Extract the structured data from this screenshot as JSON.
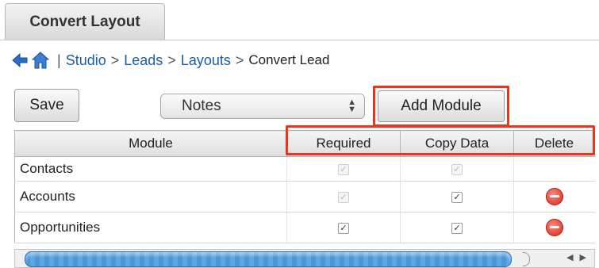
{
  "tab": {
    "label": "Convert Layout"
  },
  "breadcrumb": {
    "items": [
      "Studio",
      "Leads",
      "Layouts"
    ],
    "separator": ">",
    "current": "Convert Lead",
    "divider": "|"
  },
  "toolbar": {
    "save_label": "Save",
    "module_select_value": "Notes",
    "add_module_label": "Add Module"
  },
  "grid": {
    "columns": [
      "Module",
      "Required",
      "Copy Data",
      "Delete"
    ],
    "rows": [
      {
        "module": "Contacts",
        "required": true,
        "required_enabled": false,
        "copy": true,
        "copy_enabled": false,
        "delete": false
      },
      {
        "module": "Accounts",
        "required": true,
        "required_enabled": false,
        "copy": true,
        "copy_enabled": true,
        "delete": true
      },
      {
        "module": "Opportunities",
        "required": true,
        "required_enabled": true,
        "copy": true,
        "copy_enabled": true,
        "delete": true
      }
    ]
  },
  "colors": {
    "highlight": "#e8361a",
    "link": "#1a5ea8",
    "delete": "#d9261a"
  },
  "icons": [
    "back-arrow-icon",
    "home-icon",
    "delete-icon",
    "checkbox-icon"
  ]
}
